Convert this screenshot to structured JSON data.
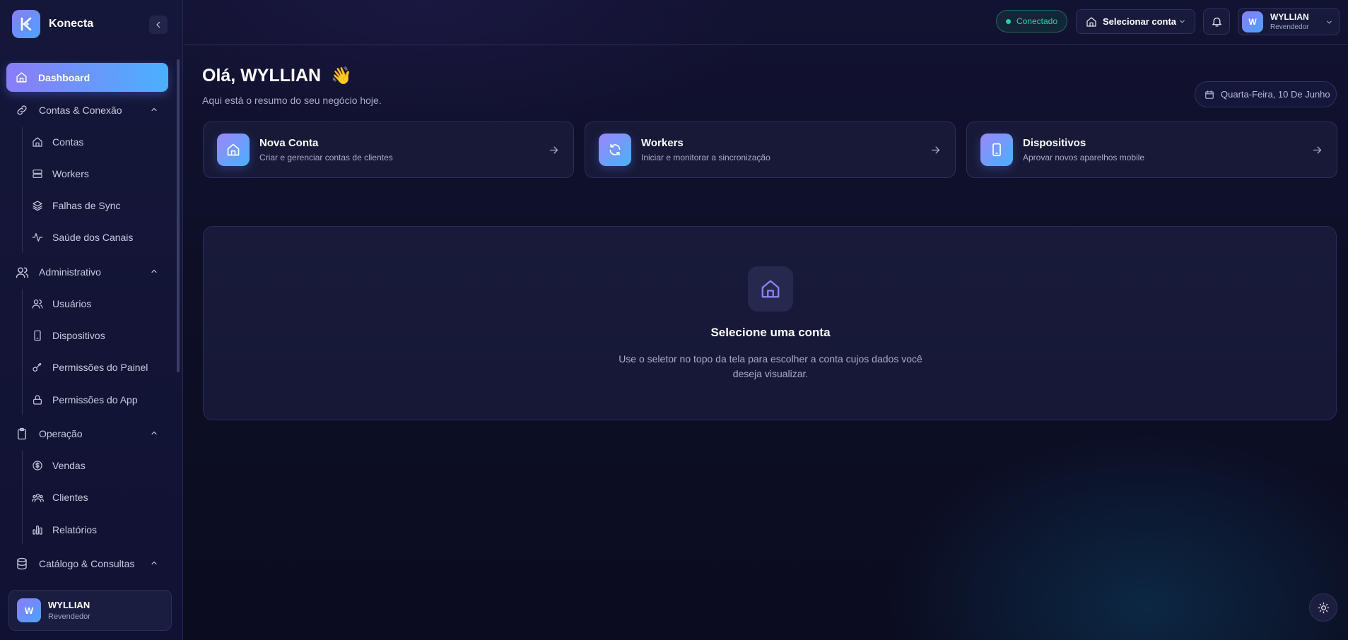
{
  "app": {
    "name": "Konecta"
  },
  "sidebar": {
    "dashboard": "Dashboard",
    "groups": [
      {
        "label": "Contas & Conexão",
        "icon": "link-icon",
        "items": [
          {
            "label": "Contas",
            "icon": "home-icon"
          },
          {
            "label": "Workers",
            "icon": "server-icon"
          },
          {
            "label": "Falhas de Sync",
            "icon": "layers-icon"
          },
          {
            "label": "Saúde dos Canais",
            "icon": "activity-icon"
          }
        ]
      },
      {
        "label": "Administrativo",
        "icon": "users-icon",
        "items": [
          {
            "label": "Usuários",
            "icon": "users-icon"
          },
          {
            "label": "Dispositivos",
            "icon": "smartphone-icon"
          },
          {
            "label": "Permissões do Painel",
            "icon": "key-icon"
          },
          {
            "label": "Permissões do App",
            "icon": "lock-icon"
          }
        ]
      },
      {
        "label": "Operação",
        "icon": "clipboard-icon",
        "items": [
          {
            "label": "Vendas",
            "icon": "dollar-circle-icon"
          },
          {
            "label": "Clientes",
            "icon": "group-icon"
          },
          {
            "label": "Relatórios",
            "icon": "bar-chart-icon"
          }
        ]
      },
      {
        "label": "Catálogo & Consultas",
        "icon": "database-icon",
        "items": []
      }
    ],
    "user": {
      "initial": "W",
      "name": "WYLLIAN",
      "role": "Revendedor"
    }
  },
  "header": {
    "status": "Conectado",
    "account_select": "Selecionar conta",
    "user": {
      "initial": "W",
      "name": "WYLLIAN",
      "role": "Revendedor"
    }
  },
  "main": {
    "greeting": "Olá, WYLLIAN",
    "wave": "👋",
    "subtitle": "Aqui está o resumo do seu negócio hoje.",
    "date": "Quarta-Feira, 10 De Junho",
    "cards": [
      {
        "title": "Nova Conta",
        "desc": "Criar e gerenciar contas de clientes",
        "icon": "home-icon"
      },
      {
        "title": "Workers",
        "desc": "Iniciar e monitorar a sincronização",
        "icon": "refresh-icon"
      },
      {
        "title": "Dispositivos",
        "desc": "Aprovar novos aparelhos mobile",
        "icon": "smartphone-icon"
      }
    ],
    "empty": {
      "title": "Selecione uma conta",
      "desc": "Use o seletor no topo da tela para escolher a conta cujos dados você deseja visualizar."
    }
  },
  "colors": {
    "accent_start": "#8b7cf6",
    "accent_end": "#4ab0ff",
    "status_green": "#22d39a",
    "background": "#0d0e23"
  }
}
